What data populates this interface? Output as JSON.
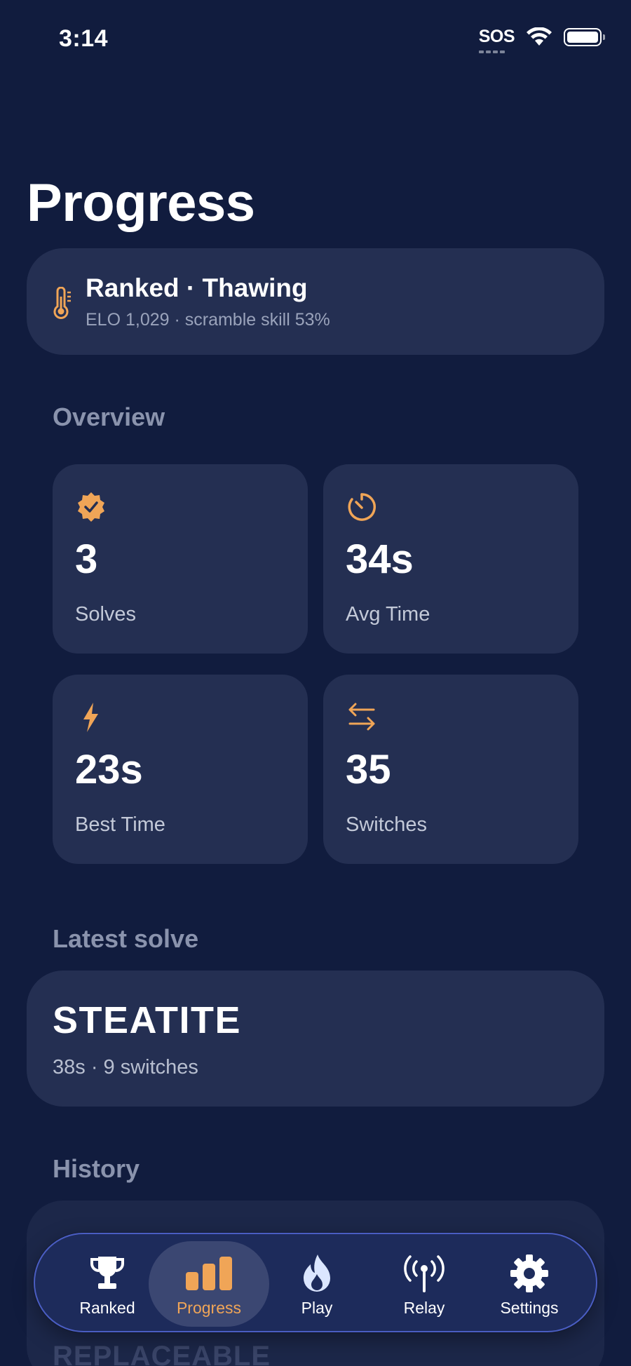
{
  "status_bar": {
    "time": "3:14",
    "sos": "SOS"
  },
  "page": {
    "title": "Progress"
  },
  "rank_card": {
    "icon": "thermometer-icon",
    "title": "Ranked · Thawing",
    "subtitle": "ELO 1,029 · scramble skill 53%"
  },
  "overview": {
    "heading": "Overview",
    "stats": [
      {
        "icon": "verified-badge-icon",
        "value": "3",
        "label": "Solves"
      },
      {
        "icon": "timer-icon",
        "value": "34s",
        "label": "Avg Time"
      },
      {
        "icon": "lightning-icon",
        "value": "23s",
        "label": "Best Time"
      },
      {
        "icon": "arrows-swap-icon",
        "value": "35",
        "label": "Switches"
      }
    ]
  },
  "latest_solve": {
    "heading": "Latest solve",
    "word": "STEATITE",
    "meta": "38s · 9 switches"
  },
  "history": {
    "heading": "History",
    "next_word": "REPLACEABLE"
  },
  "tabbar": {
    "active": "Progress",
    "tabs": [
      {
        "icon": "trophy-icon",
        "label": "Ranked"
      },
      {
        "icon": "bar-chart-icon",
        "label": "Progress"
      },
      {
        "icon": "flame-icon",
        "label": "Play"
      },
      {
        "icon": "antenna-icon",
        "label": "Relay"
      },
      {
        "icon": "gear-icon",
        "label": "Settings"
      }
    ]
  },
  "colors": {
    "background": "#111c3e",
    "card": "#242f52",
    "accent": "#f0a557",
    "muted": "#8a93ad"
  }
}
